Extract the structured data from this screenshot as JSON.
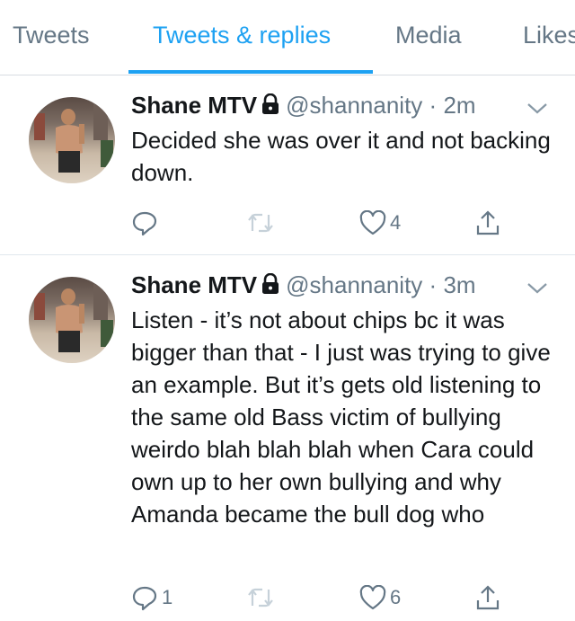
{
  "tabs": [
    {
      "label": "Tweets"
    },
    {
      "label": "Tweets & replies"
    },
    {
      "label": "Media"
    },
    {
      "label": "Likes"
    }
  ],
  "active_tab": "Tweets & replies",
  "colors": {
    "accent": "#1da1f2",
    "muted": "#657786",
    "text": "#14171a",
    "divider": "#e1e8ed"
  },
  "tweets": [
    {
      "name": "Shane MTV",
      "handle": "@shannanity",
      "dot": "·",
      "time": "2m",
      "text": "Decided she was over it and not backing down.",
      "reply_count": "",
      "retweet_count": "",
      "like_count": "4",
      "icons": [
        "lock-icon",
        "chevron-down-icon",
        "reply-icon",
        "retweet-icon",
        "like-icon",
        "share-icon"
      ]
    },
    {
      "name": "Shane MTV",
      "handle": "@shannanity",
      "dot": "·",
      "time": "3m",
      "text": "Listen - it’s not about chips bc it was bigger than that - I just was trying to give an example. But it’s gets old listening to the same old Bass victim of bullying weirdo blah blah blah when Cara could own up to her own bullying and why Amanda became the bull dog who",
      "reply_count": "1",
      "retweet_count": "",
      "like_count": "6",
      "icons": [
        "lock-icon",
        "chevron-down-icon",
        "reply-icon",
        "retweet-icon",
        "like-icon",
        "share-icon"
      ]
    }
  ]
}
